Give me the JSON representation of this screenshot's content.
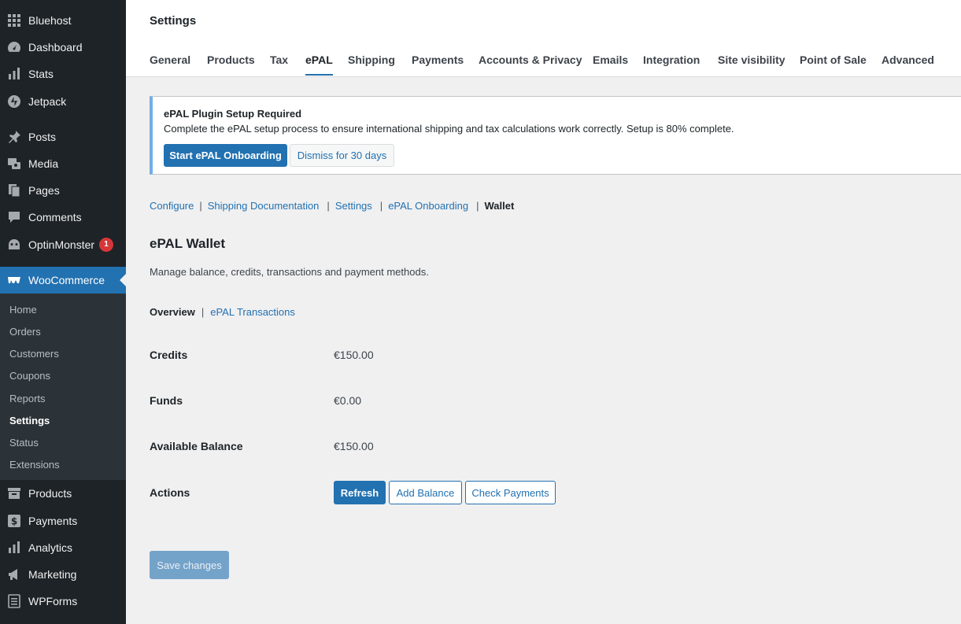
{
  "sidebar": {
    "top_items": [
      {
        "label": "Bluehost",
        "icon": "grid-icon"
      },
      {
        "label": "Dashboard",
        "icon": "dashboard-icon"
      },
      {
        "label": "Stats",
        "icon": "stats-icon"
      },
      {
        "label": "Jetpack",
        "icon": "jetpack-icon"
      },
      {
        "label": "Posts",
        "icon": "pin-icon"
      },
      {
        "label": "Media",
        "icon": "media-icon"
      },
      {
        "label": "Pages",
        "icon": "pages-icon"
      },
      {
        "label": "Comments",
        "icon": "comment-icon"
      },
      {
        "label": "OptinMonster",
        "icon": "optinmonster-icon",
        "badge": "1"
      },
      {
        "label": "WooCommerce",
        "icon": "woocommerce-icon"
      }
    ],
    "woo_submenu": [
      "Home",
      "Orders",
      "Customers",
      "Coupons",
      "Reports",
      "Settings",
      "Status",
      "Extensions"
    ],
    "bottom_items": [
      {
        "label": "Products",
        "icon": "archive-icon"
      },
      {
        "label": "Payments",
        "icon": "dollar-icon"
      },
      {
        "label": "Analytics",
        "icon": "analytics-icon"
      },
      {
        "label": "Marketing",
        "icon": "megaphone-icon"
      },
      {
        "label": "WPForms",
        "icon": "forms-icon"
      }
    ]
  },
  "header": {
    "title": "Settings",
    "tabs": [
      "General",
      "Products",
      "Tax",
      "ePAL",
      "Shipping",
      "Payments",
      "Accounts & Privacy",
      "Emails",
      "Integration",
      "Site visibility",
      "Point of Sale",
      "Advanced"
    ],
    "active_tab": "ePAL"
  },
  "notice": {
    "title": "ePAL Plugin Setup Required",
    "text": "Complete the ePAL setup process to ensure international shipping and tax calculations work correctly. Setup is 80% complete.",
    "start_label": "Start ePAL Onboarding",
    "dismiss_label": "Dismiss for 30 days"
  },
  "subnav": {
    "links": [
      "Configure",
      "Shipping Documentation",
      "Settings",
      "ePAL Onboarding"
    ],
    "current": "Wallet"
  },
  "wallet": {
    "title": "ePAL Wallet",
    "description": "Manage balance, credits, transactions and payment methods.",
    "subnav_current": "Overview",
    "subnav_link": "ePAL Transactions",
    "rows": [
      {
        "label": "Credits",
        "value": "€150.00"
      },
      {
        "label": "Funds",
        "value": "€0.00"
      },
      {
        "label": "Available Balance",
        "value": "€150.00"
      }
    ],
    "actions_label": "Actions",
    "refresh_label": "Refresh",
    "add_balance_label": "Add Balance",
    "check_payments_label": "Check Payments"
  },
  "save_label": "Save changes",
  "colors": {
    "accent": "#2271b1",
    "sidebar_bg": "#1d2327",
    "badge": "#d63638",
    "notice_border": "#72aee6"
  }
}
